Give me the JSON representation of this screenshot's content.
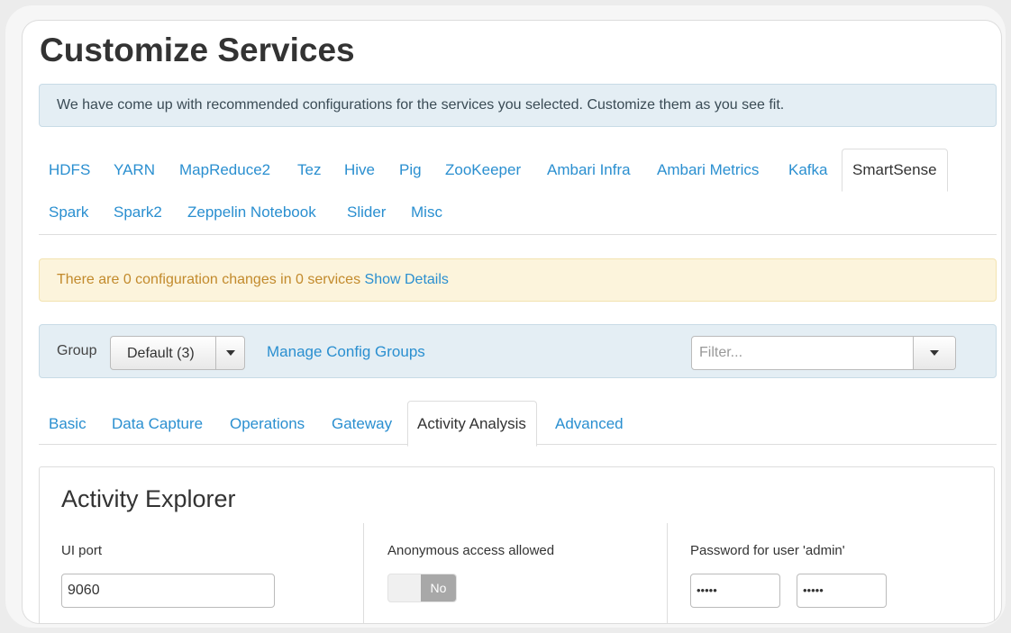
{
  "page": {
    "title": "Customize Services",
    "info_message": "We have come up with recommended configurations for the services you selected. Customize them as you see fit."
  },
  "service_tabs": {
    "row1": [
      "HDFS",
      "YARN",
      "MapReduce2",
      "Tez",
      "Hive",
      "Pig",
      "ZooKeeper",
      "Ambari Infra",
      "Ambari Metrics",
      "Kafka",
      "SmartSense"
    ],
    "row2": [
      "Spark",
      "Spark2",
      "Zeppelin Notebook",
      "Slider",
      "Misc"
    ],
    "active": "SmartSense"
  },
  "changes_alert": {
    "text": "There are 0 configuration changes in 0 services",
    "link": "Show Details"
  },
  "group_bar": {
    "label": "Group",
    "selected": "Default (3)",
    "manage_link": "Manage Config Groups",
    "filter_placeholder": "Filter..."
  },
  "config_tabs": {
    "items": [
      "Basic",
      "Data Capture",
      "Operations",
      "Gateway",
      "Activity Analysis",
      "Advanced"
    ],
    "active": "Activity Analysis"
  },
  "panel": {
    "title": "Activity Explorer",
    "ui_port_label": "UI port",
    "ui_port_value": "9060",
    "anon_label": "Anonymous access allowed",
    "anon_value": "No",
    "password_label": "Password for user 'admin'",
    "password_value": "•••••",
    "password_confirm_value": "•••••"
  },
  "colors": {
    "link": "#2a8fd0",
    "info_bg": "#e4eef4",
    "warn_bg": "#fcf4dc",
    "warn_text": "#c28a2c"
  }
}
